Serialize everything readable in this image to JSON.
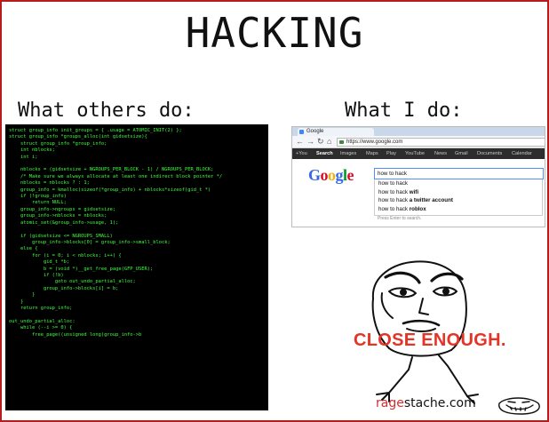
{
  "title": "HACKING",
  "left_header": "What others do:",
  "right_header": "What I do:",
  "code_lines": [
    "struct group_info init_groups = { .usage = ATOMIC_INIT(2) };",
    "struct group_info *groups_alloc(int gidsetsize){",
    "    struct group_info *group_info;",
    "    int nblocks;",
    "    int i;",
    "",
    "    nblocks = (gidsetsize + NGROUPS_PER_BLOCK - 1) / NGROUPS_PER_BLOCK;",
    "    /* Make sure we always allocate at least one indirect block pointer */",
    "    nblocks = nblocks ? : 1;",
    "    group_info = kmalloc(sizeof(*group_info) + nblocks*sizeof(gid_t *)",
    "    if (!group_info)",
    "        return NULL;",
    "    group_info->ngroups = gidsetsize;",
    "    group_info->nblocks = nblocks;",
    "    atomic_set(&group_info->usage, 1);",
    "",
    "    if (gidsetsize <= NGROUPS_SMALL)",
    "        group_info->blocks[0] = group_info->small_block;",
    "    else {",
    "        for (i = 0; i < nblocks; i++) {",
    "            gid_t *b;",
    "            b = (void *)__get_free_page(GFP_USER);",
    "            if (!b)",
    "                goto out_undo_partial_alloc;",
    "            group_info->blocks[i] = b;",
    "        }",
    "    }",
    "    return group_info;",
    "",
    "out_undo_partial_alloc:",
    "    while (--i >= 0) {",
    "        free_page((unsigned long)group_info->b"
  ],
  "browser": {
    "tab_label": "Google",
    "url": "https://www.google.com",
    "gbar": [
      "+You",
      "Search",
      "Images",
      "Maps",
      "Play",
      "YouTube",
      "News",
      "Gmail",
      "Documents",
      "Calendar"
    ],
    "logo": "Google",
    "search_value": "how to hack",
    "suggestions": [
      {
        "prefix": "how to hack",
        "bold": ""
      },
      {
        "prefix": "how to hack ",
        "bold": "wifi"
      },
      {
        "prefix": "how to hack ",
        "bold": "a twitter account"
      },
      {
        "prefix": "how to hack ",
        "bold": "roblox"
      }
    ],
    "hint": "Press Enter to search."
  },
  "caption": "CLOSE ENOUGH.",
  "watermark": {
    "part1": "rage",
    "part2": "stache.com"
  },
  "colors": {
    "code_text": "#3dff3d",
    "caption": "#e53326",
    "frame": "#b71c1c"
  }
}
